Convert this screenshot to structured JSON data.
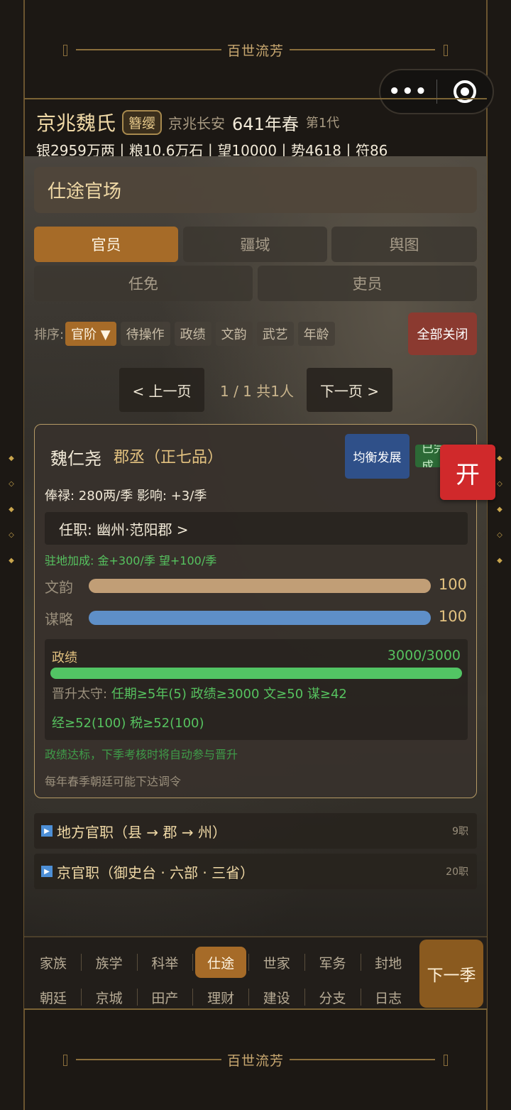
{
  "banner_text": "百世流芳",
  "capsule": {
    "more_glyph": "•••"
  },
  "header": {
    "clan_name": "京兆魏氏",
    "clan_badge": "簪缨",
    "location": "京兆长安",
    "year": "641年春",
    "generation": "第1代",
    "resources": "银2959万两丨粮10.6万石丨望10000丨势4618丨符86"
  },
  "page_title": "仕途官场",
  "tabs_row1": [
    "官员",
    "疆域",
    "舆图"
  ],
  "tabs_row2": [
    "任免",
    "吏员"
  ],
  "sort": {
    "label": "排序:",
    "chips": [
      "官阶 ▼",
      "待操作",
      "政绩",
      "文韵",
      "武艺",
      "年龄"
    ],
    "close_all": "全部关闭"
  },
  "pager": {
    "prev": "< 上一页",
    "info": "1 / 1  共1人",
    "next": "下一页 >"
  },
  "official": {
    "name": "魏仁尧",
    "title": "郡丞（正七品）",
    "balance_button": "均衡发展",
    "done_badge": "已完成",
    "salary": "俸禄: 280两/季   影响: +3/季",
    "post": "任职: 幽州·范阳郡  >",
    "bonus": "驻地加成: 金+300/季  望+100/季",
    "stats": [
      {
        "label": "文韵",
        "value": "100",
        "fraction": 1.0,
        "color": "#c19e76"
      },
      {
        "label": "谋略",
        "value": "100",
        "fraction": 1.0,
        "color": "#5e8fc8"
      }
    ],
    "performance": {
      "label": "政绩",
      "value": "3000/3000",
      "fraction": 1.0,
      "promote_key": "晋升太守:",
      "promote_conditions": "任期≥5年(5)  政绩≥3000  文≥50  谋≥42",
      "promote_conditions2": "经≥52(100)  税≥52(100)"
    },
    "note_promotion": "政绩达标，下季考核时将自动参与晋升",
    "note_decree": "每年春季朝廷可能下达调令"
  },
  "sections": [
    {
      "title": "地方官职（县 → 郡 → 州）",
      "count": "9职"
    },
    {
      "title": "京官职（御史台 · 六部 · 三省）",
      "count": "20职"
    }
  ],
  "float_button": "开",
  "nav": {
    "row1": [
      "家族",
      "族学",
      "科举",
      "仕途",
      "世家",
      "军务",
      "封地"
    ],
    "row2": [
      "朝廷",
      "京城",
      "田产",
      "理财",
      "建设",
      "分支",
      "日志"
    ],
    "active": "仕途",
    "next_season": "下一季"
  }
}
